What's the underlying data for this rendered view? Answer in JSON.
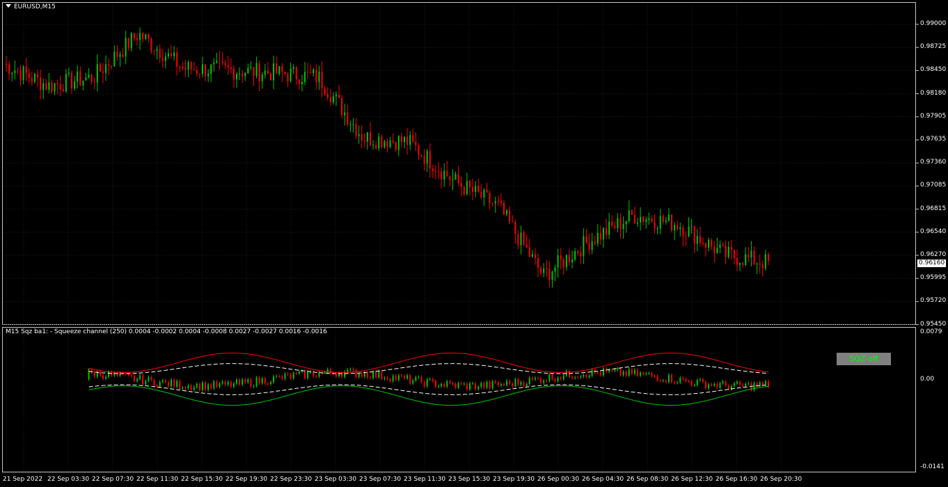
{
  "chart": {
    "symbol_title": "EURUSD,M15",
    "current_price": "0.96160",
    "price_axis": [
      "0.99000",
      "0.98725",
      "0.98450",
      "0.98180",
      "0.97905",
      "0.97635",
      "0.97360",
      "0.97085",
      "0.96815",
      "0.96540",
      "0.96270",
      "0.95995",
      "0.95720",
      "0.95450"
    ],
    "time_axis": [
      "21 Sep 2022",
      "22 Sep 03:30",
      "22 Sep 07:30",
      "22 Sep 11:30",
      "22 Sep 15:30",
      "22 Sep 19:30",
      "22 Sep 23:30",
      "23 Sep 03:30",
      "23 Sep 07:30",
      "23 Sep 11:30",
      "23 Sep 15:30",
      "23 Sep 19:30",
      "26 Sep 00:30",
      "26 Sep 04:30",
      "26 Sep 08:30",
      "26 Sep 12:30",
      "26 Sep 16:30",
      "26 Sep 20:30"
    ]
  },
  "indicator": {
    "title": "M15 Sqz ba1: - Squeeze channel (250) 0.0004 -0.0002 0.0004 -0.0008 0.0027 -0.0027 0.0016 -0.0016",
    "axis": [
      "0.0079",
      "0.00",
      "-0.0141"
    ],
    "status_label": "SQZ-off"
  },
  "colors": {
    "bull": "#00c800",
    "bear": "#ff0000",
    "grid": "#1e1e1e",
    "band_upper": "#ff0000",
    "band_lower": "#00c800",
    "mid": "#ffffff"
  },
  "chart_data": {
    "type": "line",
    "title": "EURUSD,M15",
    "x": [
      "21 Sep 2022",
      "22 Sep 03:30",
      "22 Sep 07:30",
      "22 Sep 11:30",
      "22 Sep 15:30",
      "22 Sep 19:30",
      "22 Sep 23:30",
      "23 Sep 03:30",
      "23 Sep 07:30",
      "23 Sep 11:30",
      "23 Sep 15:30",
      "23 Sep 19:30",
      "26 Sep 00:30",
      "26 Sep 04:30",
      "26 Sep 08:30",
      "26 Sep 12:30",
      "26 Sep 16:30",
      "26 Sep 20:30"
    ],
    "series": [
      {
        "name": "EURUSD,M15",
        "values": [
          0.9845,
          0.982,
          0.983,
          0.988,
          0.984,
          0.9838,
          0.9835,
          0.983,
          0.976,
          0.9755,
          0.971,
          0.968,
          0.96,
          0.964,
          0.967,
          0.966,
          0.9625,
          0.9615
        ]
      }
    ],
    "ylim": [
      0.9545,
      0.9915
    ]
  }
}
